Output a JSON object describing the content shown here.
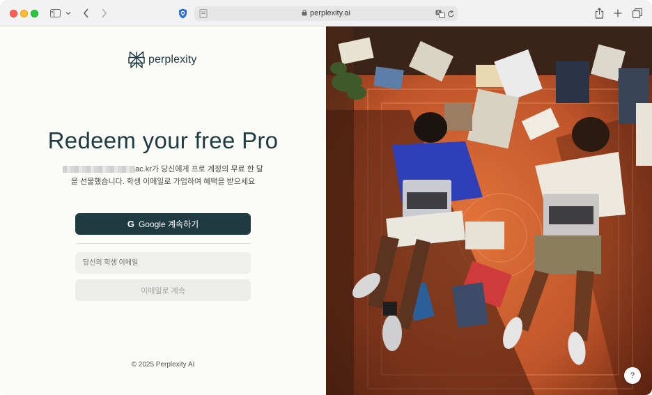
{
  "browser": {
    "url": "perplexity.ai",
    "icons": [
      "sidebar-icon",
      "chevron-down-icon",
      "back-icon",
      "forward-icon",
      "privacy-shield-icon",
      "page-icon",
      "lock-icon",
      "translate-icon",
      "reload-icon",
      "share-icon",
      "new-tab-icon",
      "tab-overview-icon"
    ]
  },
  "page": {
    "brand": "perplexity",
    "headline": "Redeem your free Pro",
    "description_line1_suffix": "ac.kr가 당신에게 프로 계정의 무료 한 달",
    "description_line2": "을 선물했습니다. 학생 이메일로 가입하여 혜택을 받으세요",
    "google_button_label": "Google 계속하기",
    "google_icon_letter": "G",
    "email_placeholder": "당신의 학생 이메일",
    "email_button_label": "이메일로 계속",
    "copyright": "© 2025 Perplexity AI",
    "help_label": "?"
  },
  "colors": {
    "brand_dark": "#1f3a40",
    "page_bg": "#fbfbf7"
  }
}
